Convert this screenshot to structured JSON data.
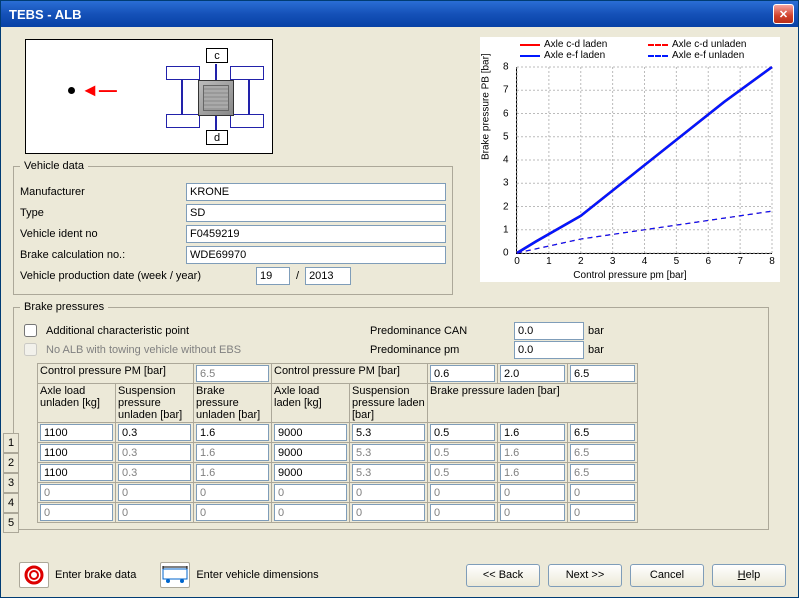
{
  "window": {
    "title": "TEBS - ALB"
  },
  "diagram": {
    "label_top": "c",
    "label_bottom": "d"
  },
  "vehicle_data": {
    "legend": "Vehicle data",
    "rows": {
      "manufacturer": {
        "label": "Manufacturer",
        "value": "KRONE"
      },
      "type": {
        "label": "Type",
        "value": "SD"
      },
      "ident": {
        "label": "Vehicle ident no",
        "value": "F0459219"
      },
      "calc": {
        "label": "Brake calculation no.:",
        "value": "WDE69970"
      },
      "prod_date": {
        "label": "Vehicle production date (week / year)",
        "week": "19",
        "sep": "/",
        "year": "2013"
      }
    }
  },
  "brake_pressures": {
    "legend": "Brake pressures",
    "chk_additional": "Additional characteristic point",
    "chk_noalb": "No ALB with towing vehicle without EBS",
    "predominance_can": {
      "label": "Predominance CAN",
      "value": "0.0",
      "unit": "bar"
    },
    "predominance_pm": {
      "label": "Predominance pm",
      "value": "0.0",
      "unit": "bar"
    },
    "cp_label": "Control pressure PM [bar]",
    "cp_left": "6.5",
    "cp_right": [
      "0.6",
      "2.0",
      "6.5"
    ],
    "headers": {
      "axle_unladen": "Axle load unladen [kg]",
      "susp_unladen": "Suspension pressure unladen [bar]",
      "bp_unladen": "Brake pressure unladen [bar]",
      "axle_laden": "Axle load laden [kg]",
      "susp_laden": "Suspension pressure laden [bar]",
      "bp_laden": "Brake pressure laden [bar]"
    },
    "rows": [
      {
        "n": "1",
        "au": "1100",
        "su": "0.3",
        "bu": "1.6",
        "al": "9000",
        "sl": "5.3",
        "b1": "0.5",
        "b2": "1.6",
        "b3": "6.5",
        "active": true
      },
      {
        "n": "2",
        "au": "1100",
        "su": "0.3",
        "bu": "1.6",
        "al": "9000",
        "sl": "5.3",
        "b1": "0.5",
        "b2": "1.6",
        "b3": "6.5",
        "active": false
      },
      {
        "n": "3",
        "au": "1100",
        "su": "0.3",
        "bu": "1.6",
        "al": "9000",
        "sl": "5.3",
        "b1": "0.5",
        "b2": "1.6",
        "b3": "6.5",
        "active": false
      },
      {
        "n": "4",
        "au": "0",
        "su": "0",
        "bu": "0",
        "al": "0",
        "sl": "0",
        "b1": "0",
        "b2": "0",
        "b3": "0",
        "active": false
      },
      {
        "n": "5",
        "au": "0",
        "su": "0",
        "bu": "0",
        "al": "0",
        "sl": "0",
        "b1": "0",
        "b2": "0",
        "b3": "0",
        "active": false
      }
    ]
  },
  "chart_data": {
    "type": "line",
    "xlabel": "Control pressure pm [bar]",
    "ylabel": "Brake pressure PB [bar]",
    "xlim": [
      0,
      8
    ],
    "ylim": [
      0,
      8
    ],
    "legend": [
      "Axle c-d laden",
      "Axle c-d unladen",
      "Axle e-f laden",
      "Axle e-f unladen"
    ],
    "colors": {
      "cd_laden": "#ff0000",
      "cd_unladen": "#ff0000",
      "ef_laden": "#0018ff",
      "ef_unladen": "#0018ff"
    },
    "series": [
      {
        "name": "Axle c-d laden",
        "style": "solid",
        "color": "#ff0000",
        "x": [
          0,
          0.6,
          2.0,
          6.5,
          8
        ],
        "y": [
          0,
          0.5,
          1.6,
          6.5,
          8.0
        ]
      },
      {
        "name": "Axle e-f laden",
        "style": "solid",
        "color": "#0018ff",
        "x": [
          0,
          0.6,
          2.0,
          6.5,
          8
        ],
        "y": [
          0,
          0.5,
          1.6,
          6.5,
          8.0
        ]
      },
      {
        "name": "Axle c-d unladen",
        "style": "dashed",
        "color": "#ff0000",
        "x": [
          0,
          2.0,
          8
        ],
        "y": [
          0,
          0.6,
          1.8
        ]
      },
      {
        "name": "Axle e-f unladen",
        "style": "dashed",
        "color": "#0018ff",
        "x": [
          0,
          2.0,
          8
        ],
        "y": [
          0,
          0.6,
          1.8
        ]
      }
    ]
  },
  "buttons": {
    "enter_brake": "Enter brake data",
    "enter_dim": "Enter vehicle dimensions",
    "back": "<< Back",
    "next": "Next >>",
    "cancel": "Cancel",
    "help": "Help"
  }
}
